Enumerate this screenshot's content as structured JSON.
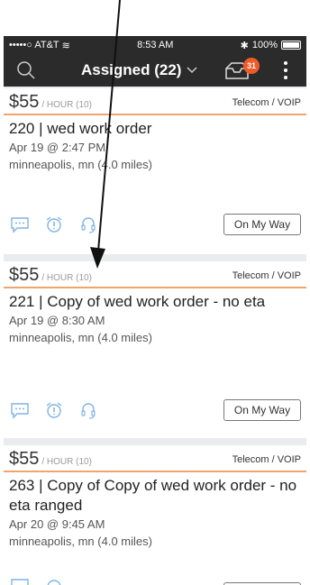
{
  "status_bar": {
    "carrier": "•••••○ AT&T",
    "time": "8:53 AM",
    "battery": "100%"
  },
  "header": {
    "title": "Assigned (22)",
    "inbox_badge": "31"
  },
  "work_orders": [
    {
      "price": "$55",
      "unit": "/ HOUR (10)",
      "category": "Telecom / VOIP",
      "title": "220 | wed work order",
      "date": "Apr 19 @ 2:47 PM",
      "location": "minneapolis, mn (4.0 miles)",
      "button": "On My Way"
    },
    {
      "price": "$55",
      "unit": "/ HOUR (10)",
      "category": "Telecom / VOIP",
      "title": "221 | Copy of wed work order - no eta",
      "date": "Apr 19 @ 8:30 AM",
      "location": "minneapolis, mn (4.0 miles)",
      "button": "On My Way"
    },
    {
      "price": "$55",
      "unit": "/ HOUR (10)",
      "category": "Telecom / VOIP",
      "title": "263 | Copy of Copy of wed work order - no eta ranged",
      "date": "Apr 20 @ 9:45 AM",
      "location": "minneapolis, mn (4.0 miles)",
      "button": ""
    }
  ],
  "colors": {
    "accent": "#f05a28",
    "divider": "#f2a36e",
    "icon_blue": "#7fb3e6",
    "bar": "#2b2b2b"
  }
}
